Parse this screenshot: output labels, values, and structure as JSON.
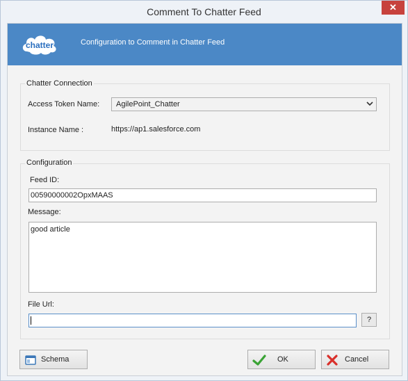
{
  "window": {
    "title": "Comment To Chatter Feed",
    "close_glyph": "✕"
  },
  "banner": {
    "logo_text": "chatter",
    "heading": "Configuration to Comment in Chatter Feed"
  },
  "connection": {
    "legend": "Chatter Connection",
    "access_token_label": "Access Token Name:",
    "access_token_value": "AgilePoint_Chatter",
    "instance_label": "Instance Name :",
    "instance_value": "https://ap1.salesforce.com"
  },
  "configuration": {
    "legend": "Configuration",
    "feed_id_label": "Feed ID:",
    "feed_id_value": "00590000002OpxMAAS",
    "message_label": "Message:",
    "message_value": "good article",
    "file_url_label": "File Url:",
    "file_url_value": "",
    "help_button": "?"
  },
  "buttons": {
    "schema": "Schema",
    "ok": "OK",
    "cancel": "Cancel"
  },
  "icons": {
    "schema": "window-icon",
    "ok": "checkmark-icon",
    "cancel": "cross-icon",
    "dropdown": "chevron-down-icon"
  },
  "colors": {
    "banner": "#4b88c6",
    "close": "#c7423d",
    "ok_check": "#3aa335",
    "cancel_x": "#d9302b"
  }
}
